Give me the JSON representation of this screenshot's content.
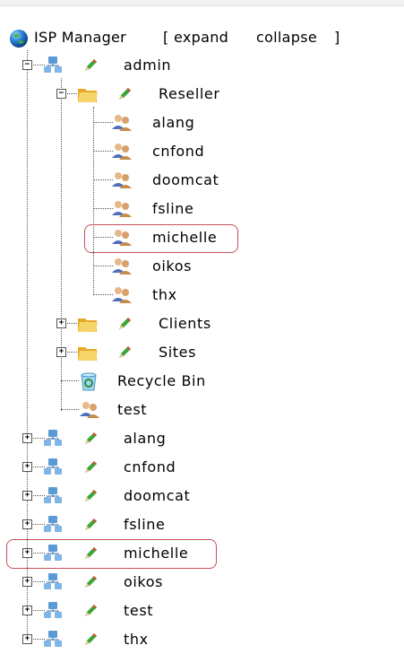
{
  "root": {
    "title": "ISP Manager",
    "bracket_open": "[",
    "expand_label": "expand",
    "collapse_label": "collapse",
    "bracket_close": "]"
  },
  "tree": {
    "admin": {
      "label": "admin",
      "expander": "−",
      "reseller": {
        "label": "Reseller",
        "expander": "−",
        "users": [
          "alang",
          "cnfond",
          "doomcat",
          "fsline",
          "michelle",
          "oikos",
          "thx"
        ]
      },
      "clients": {
        "label": "Clients",
        "expander": "+"
      },
      "sites": {
        "label": "Sites",
        "expander": "+"
      },
      "recycle_bin": {
        "label": "Recycle Bin"
      },
      "test_user": {
        "label": "test"
      }
    },
    "top_level": [
      {
        "label": "alang",
        "expander": "+"
      },
      {
        "label": "cnfond",
        "expander": "+"
      },
      {
        "label": "doomcat",
        "expander": "+"
      },
      {
        "label": "fsline",
        "expander": "+"
      },
      {
        "label": "michelle",
        "expander": "+"
      },
      {
        "label": "oikos",
        "expander": "+"
      },
      {
        "label": "test",
        "expander": "+"
      },
      {
        "label": "thx",
        "expander": "+"
      }
    ],
    "highlighted": [
      "michelle (reseller)",
      "michelle (top level)"
    ]
  },
  "colors": {
    "highlight": "#c4505a",
    "tree_line": "#555555",
    "folder": "#f2c24a",
    "network_icon": "#5b9bd5",
    "pencil": "#3aa635"
  },
  "icons": {
    "root": "globe-icon",
    "account": "network-computer-icon",
    "edit": "pencil-edit-icon",
    "folder": "folder-icon",
    "user": "users-icon",
    "recycle": "recycle-bin-icon"
  }
}
